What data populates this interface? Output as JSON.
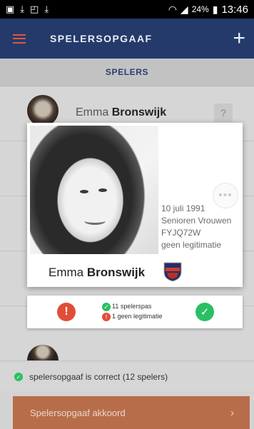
{
  "status_bar": {
    "battery": "24%",
    "time": "13:46",
    "notification_icons": [
      "gallery-icon",
      "download-icon",
      "screenshot-icon",
      "download-icon"
    ]
  },
  "app_bar": {
    "title": "SPELERSOPGAAF",
    "add_label": "+"
  },
  "tab": {
    "label": "SPELERS"
  },
  "list": {
    "rows": [
      {
        "first_name": "Emma",
        "last_name": "Bronswijk",
        "badge": "?"
      },
      {
        "first_name": "",
        "last_name": "",
        "badge": ""
      },
      {
        "first_name": "",
        "last_name": "",
        "badge": ""
      },
      {
        "first_name": "",
        "last_name": "",
        "badge": ""
      },
      {
        "first_name": "",
        "last_name": "",
        "badge": ""
      }
    ]
  },
  "player_card": {
    "first_name": "Emma",
    "last_name": "Bronswijk",
    "birth_date": "10 juli 1991",
    "team": "Senioren Vrouwen",
    "code": "FYJQ72W",
    "id_status": "geen legitimatie",
    "more_label": "•••"
  },
  "summary": {
    "pass_count": "11 spelerspas",
    "missing_id": "1 geen legitimatie",
    "reject_icon": "exclamation-icon",
    "accept_icon": "check-icon"
  },
  "validation": {
    "message": "spelersopgaaf is correct (12 spelers)"
  },
  "footer": {
    "button_label": "Spelersopgaaf akkoord",
    "arrow": "›"
  },
  "colors": {
    "app_bar": "#243a6b",
    "accent": "#e2563b",
    "success": "#2bbf63",
    "error": "#e04e3a",
    "button": "#b86d4a"
  }
}
